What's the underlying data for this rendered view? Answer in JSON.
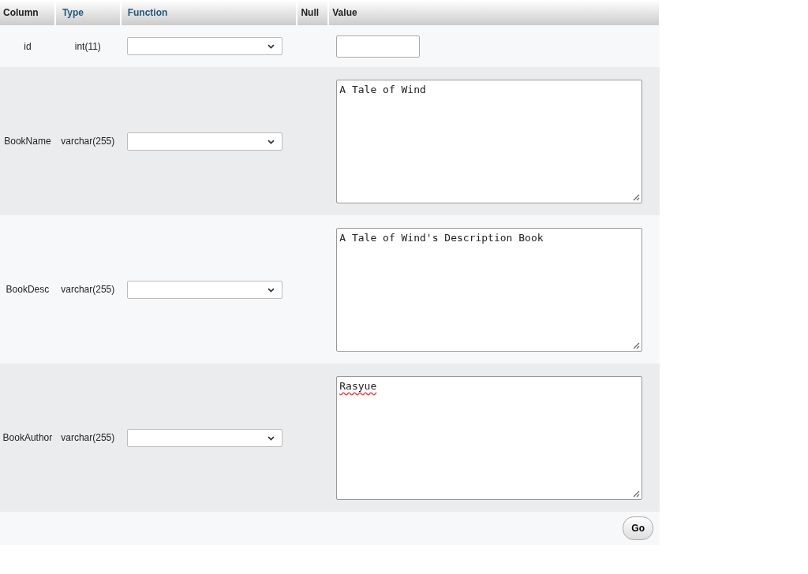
{
  "table": {
    "columns": [
      {
        "label": "Column",
        "sortable": false
      },
      {
        "label": "Type",
        "sortable": true
      },
      {
        "label": "Function",
        "sortable": true
      },
      {
        "label": "Null",
        "sortable": false
      },
      {
        "label": "Value",
        "sortable": false
      }
    ],
    "rows": [
      {
        "column": "id",
        "type": "int(11)",
        "kind": "input",
        "value": "",
        "spelling_flagged": false
      },
      {
        "column": "BookName",
        "type": "varchar(255)",
        "kind": "textarea",
        "value": "A Tale of Wind",
        "spelling_flagged": false
      },
      {
        "column": "BookDesc",
        "type": "varchar(255)",
        "kind": "textarea",
        "value": "A Tale of Wind's Description Book",
        "spelling_flagged": false
      },
      {
        "column": "BookAuthor",
        "type": "varchar(255)",
        "kind": "textarea",
        "value": "Rasyue",
        "spelling_flagged": true
      }
    ]
  },
  "submit_button": "Go"
}
